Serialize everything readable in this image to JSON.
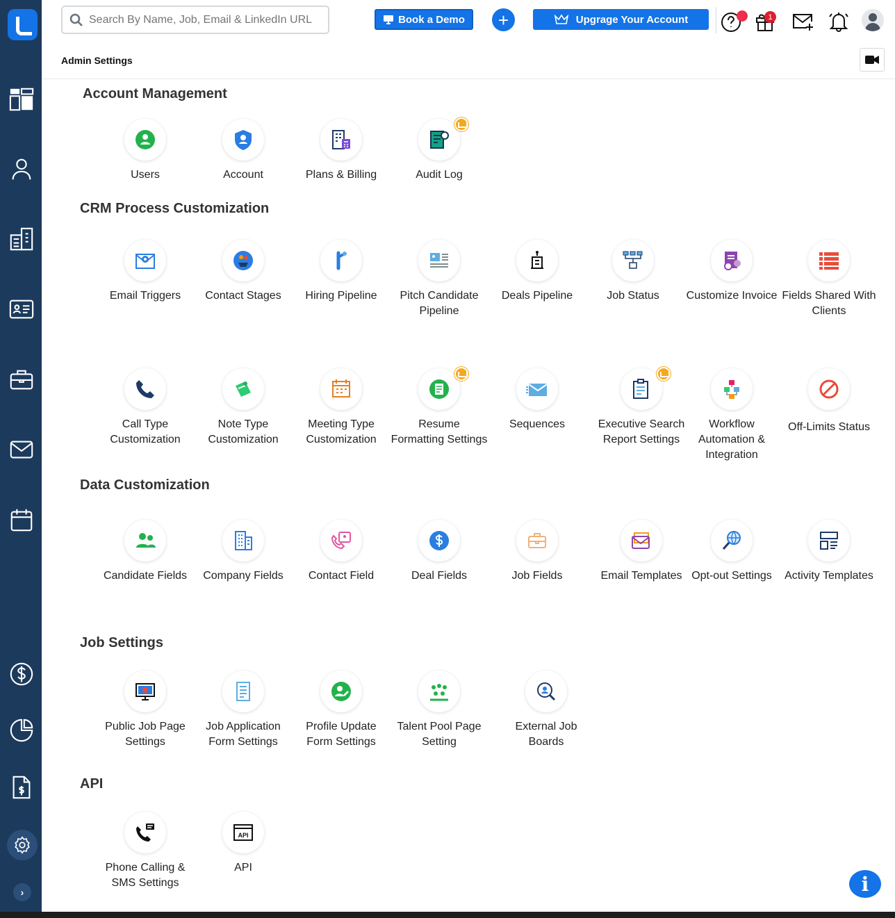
{
  "topbar": {
    "search_placeholder": "Search By Name, Job, Email & LinkedIn URL",
    "book_demo": "Book a Demo",
    "upgrade": "Upgrage Your Account",
    "gift_badge": "1"
  },
  "header": {
    "title": "Admin Settings"
  },
  "sections": {
    "account": {
      "title": "Account Management",
      "items": [
        "Users",
        "Account",
        "Plans & Billing",
        "Audit Log"
      ]
    },
    "crm": {
      "title": "CRM Process Customization",
      "items": [
        "Email Triggers",
        "Contact Stages",
        "Hiring Pipeline",
        "Pitch Candidate Pipeline",
        "Deals Pipeline",
        "Job Status",
        "Customize Invoice",
        "Fields Shared With Clients",
        "Call Type Customization",
        "Note Type Customization",
        "Meeting Type Customization",
        "Resume Formatting Settings",
        "Sequences",
        "Executive Search Report Settings",
        "Workflow Automation & Integration",
        "Off-Limits Status"
      ]
    },
    "data": {
      "title": "Data Customization",
      "items": [
        "Candidate Fields",
        "Company Fields",
        "Contact Field",
        "Deal Fields",
        "Job Fields",
        "Email Templates",
        "Opt-out Settings",
        "Activity Templates"
      ]
    },
    "job": {
      "title": "Job Settings",
      "items": [
        "Public Job Page Settings",
        "Job Application Form Settings",
        "Profile Update Form Settings",
        "Talent Pool Page Setting",
        "External Job Boards"
      ]
    },
    "api": {
      "title": "API",
      "items": [
        "Phone Calling & SMS Settings",
        "API"
      ]
    }
  },
  "colors": {
    "sidebar": "#1c3a5c",
    "accent": "#1473e6",
    "premium": "#f6a81c"
  }
}
